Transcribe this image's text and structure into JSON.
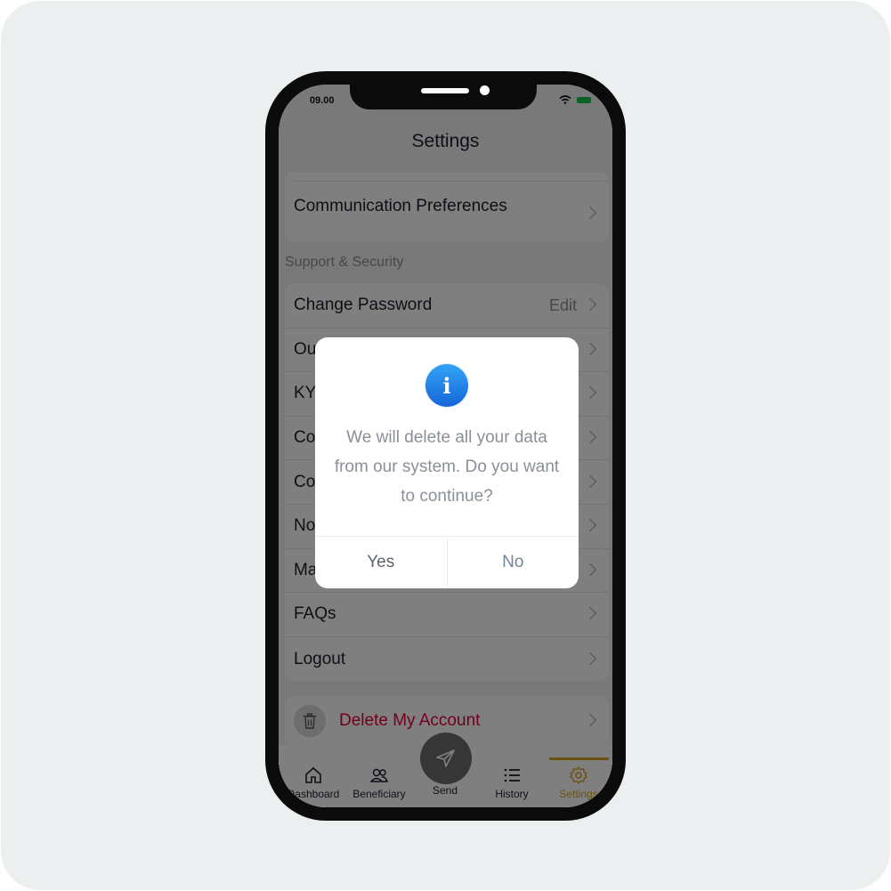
{
  "status_bar": {
    "time": "09.00"
  },
  "header": {
    "title": "Settings"
  },
  "preferences_card": {
    "items": [
      {
        "label": "Communication Preferences"
      }
    ]
  },
  "support_security": {
    "section_label": "Support & Security",
    "items": [
      {
        "label": "Change Password",
        "action": "Edit"
      },
      {
        "label": "Ou"
      },
      {
        "label": "KY"
      },
      {
        "label": "Co"
      },
      {
        "label": "Co"
      },
      {
        "label": "No"
      },
      {
        "label": "Ma"
      },
      {
        "label": "FAQs"
      },
      {
        "label": "Logout"
      }
    ]
  },
  "danger": {
    "label": "Delete My Account",
    "color": "#e4003a"
  },
  "tabbar": {
    "tabs": [
      {
        "label": "Dashboard",
        "icon": "home-icon"
      },
      {
        "label": "Beneficiary",
        "icon": "users-icon"
      },
      {
        "label": "Send",
        "icon": "send-icon"
      },
      {
        "label": "History",
        "icon": "list-icon"
      },
      {
        "label": "Settings",
        "icon": "gear-icon",
        "active": true
      }
    ],
    "active_color": "#d9a422"
  },
  "dialog": {
    "icon": "info-icon",
    "message": "We will delete all your data from our system. Do you want to continue?",
    "yes_label": "Yes",
    "no_label": "No"
  }
}
